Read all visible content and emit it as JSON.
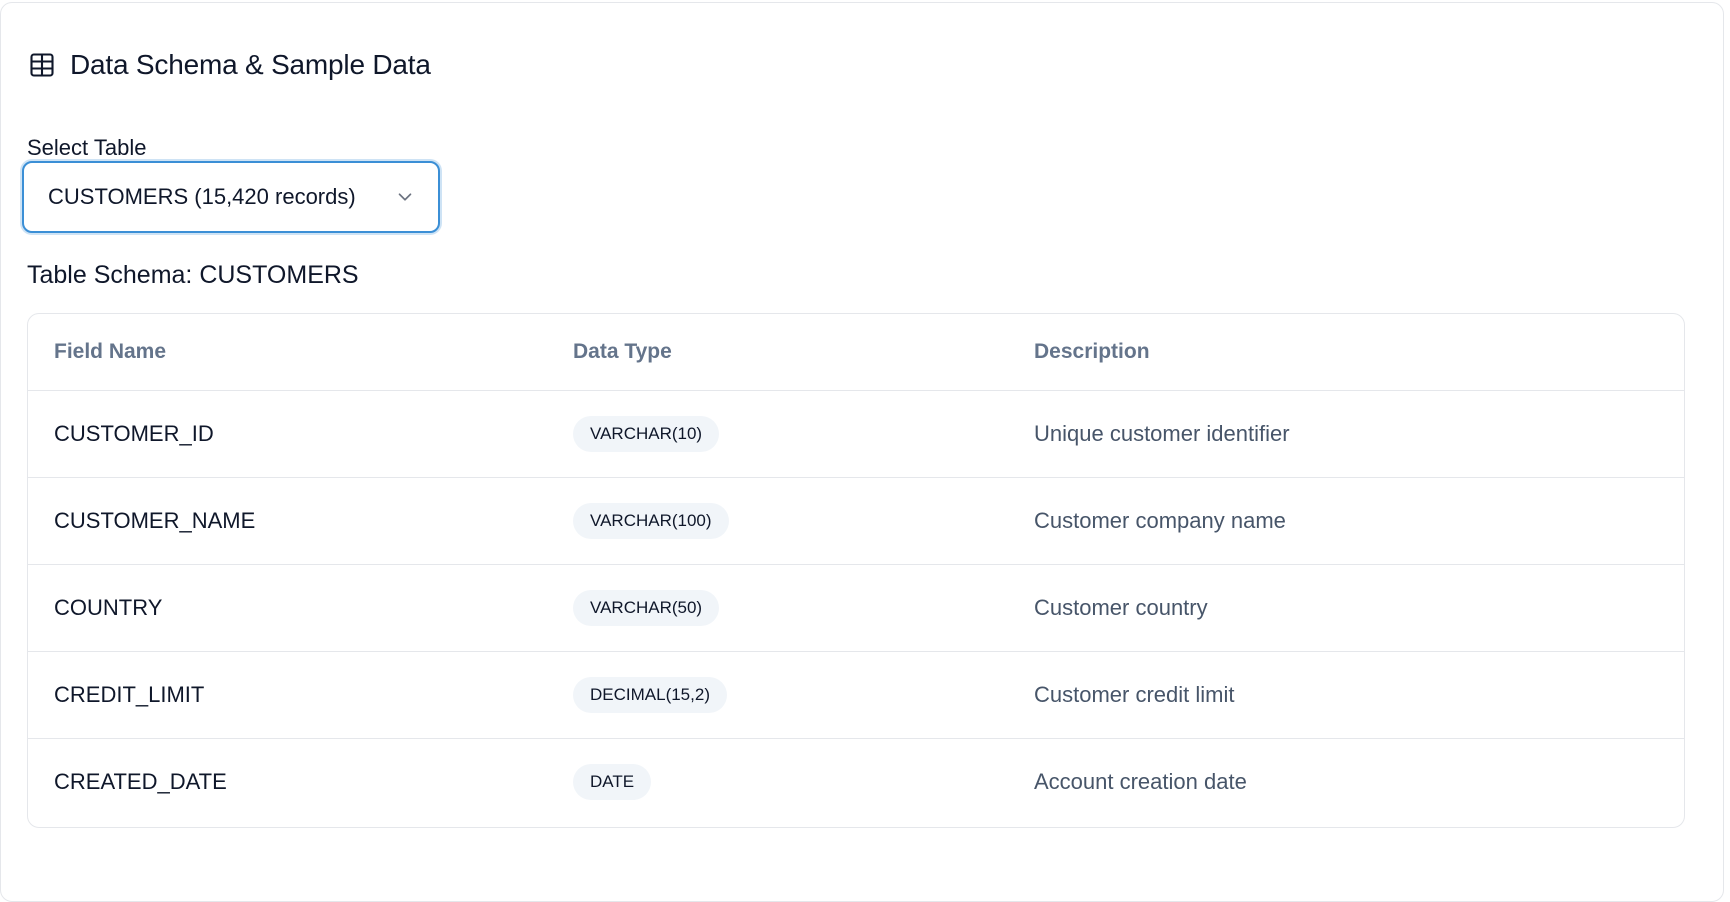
{
  "header": {
    "icon": "table-icon",
    "title": "Data Schema & Sample Data"
  },
  "select": {
    "label": "Select Table",
    "value": "CUSTOMERS (15,420 records)",
    "icon": "chevron-down-icon"
  },
  "schema": {
    "title": "Table Schema: CUSTOMERS",
    "columns": [
      "Field Name",
      "Data Type",
      "Description"
    ],
    "rows": [
      {
        "field": "CUSTOMER_ID",
        "type": "VARCHAR(10)",
        "description": "Unique customer identifier"
      },
      {
        "field": "CUSTOMER_NAME",
        "type": "VARCHAR(100)",
        "description": "Customer company name"
      },
      {
        "field": "COUNTRY",
        "type": "VARCHAR(50)",
        "description": "Customer country"
      },
      {
        "field": "CREDIT_LIMIT",
        "type": "DECIMAL(15,2)",
        "description": "Customer credit limit"
      },
      {
        "field": "CREATED_DATE",
        "type": "DATE",
        "description": "Account creation date"
      }
    ]
  },
  "colors": {
    "accent": "#3b8fd6",
    "muted_text": "#64748b",
    "border": "#e5e7eb",
    "badge_bg": "#f1f5f9"
  }
}
